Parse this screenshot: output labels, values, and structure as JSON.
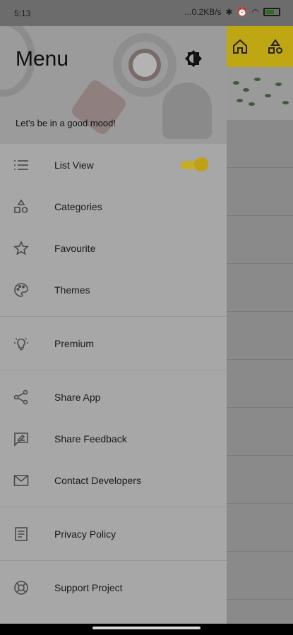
{
  "status_bar": {
    "time": "5:13",
    "net": "...0.2KB/s",
    "battery": "battery-icon"
  },
  "drawer": {
    "title": "Menu",
    "tagline": "Let's be in a good mood!",
    "items": [
      {
        "label": "List View",
        "icon": "list-icon",
        "toggle": true,
        "toggle_on": true
      },
      {
        "label": "Categories",
        "icon": "categories-icon"
      },
      {
        "label": "Favourite",
        "icon": "star-icon"
      },
      {
        "label": "Themes",
        "icon": "palette-icon"
      },
      {
        "label": "Premium",
        "icon": "bulb-icon"
      },
      {
        "label": "Share App",
        "icon": "share-icon"
      },
      {
        "label": "Share Feedback",
        "icon": "feedback-icon"
      },
      {
        "label": "Contact Developers",
        "icon": "mail-icon"
      },
      {
        "label": "Privacy Policy",
        "icon": "document-icon"
      },
      {
        "label": "Support Project",
        "icon": "support-icon"
      }
    ]
  },
  "colors": {
    "accent": "#bfa113",
    "scrim": "#8a8a8a"
  }
}
